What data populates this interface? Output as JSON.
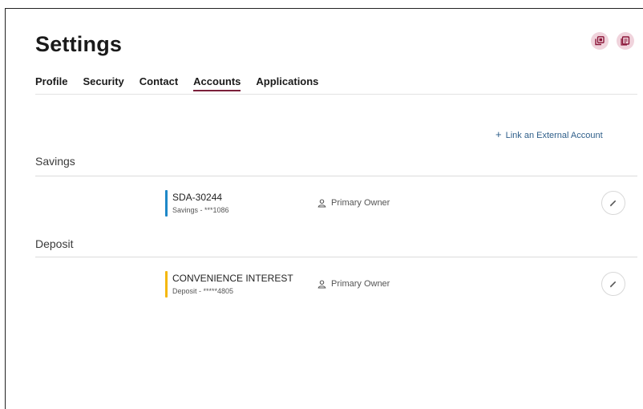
{
  "page": {
    "title": "Settings"
  },
  "header_icons": [
    {
      "icon": "copy-document-icon"
    },
    {
      "icon": "document-list-icon"
    }
  ],
  "tabs": [
    {
      "label": "Profile",
      "active": false
    },
    {
      "label": "Security",
      "active": false
    },
    {
      "label": "Contact",
      "active": false
    },
    {
      "label": "Accounts",
      "active": true
    },
    {
      "label": "Applications",
      "active": false
    }
  ],
  "link_external": {
    "icon": "plus-icon",
    "label": "Link an External Account"
  },
  "sections": [
    {
      "heading": "Savings",
      "accounts": [
        {
          "name": "SDA-30244",
          "subtitle": "Savings - ***1086",
          "owner": "Primary Owner",
          "color": "#1e88c8"
        }
      ]
    },
    {
      "heading": "Deposit",
      "accounts": [
        {
          "name": "CONVENIENCE INTEREST",
          "subtitle": "Deposit - *****4805",
          "owner": "Primary Owner",
          "color": "#f5b80f"
        }
      ]
    }
  ],
  "colors": {
    "accent": "#7b1f3a",
    "link": "#2f5f8a",
    "icon_bg": "#f0d3dc"
  }
}
